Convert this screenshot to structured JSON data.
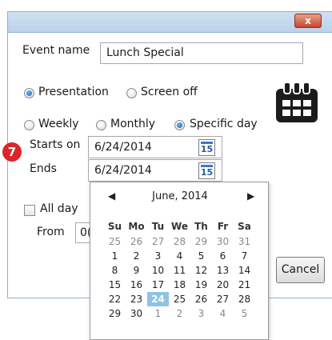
{
  "window": {
    "close_glyph": "x"
  },
  "event_name": {
    "label": "Event name",
    "value": "Lunch Special"
  },
  "mode": {
    "presentation": "Presentation",
    "screen_off": "Screen off",
    "selected": "Presentation"
  },
  "recurrence": {
    "weekly": "Weekly",
    "monthly": "Monthly",
    "specific_day": "Specific day",
    "selected": "Specific day"
  },
  "starts": {
    "label": "Starts on",
    "value": "6/24/2014",
    "icon_text": "15"
  },
  "ends": {
    "label": "Ends",
    "value": "6/24/2014",
    "icon_text": "15"
  },
  "step_badge": "7",
  "all_day": {
    "label": "All day",
    "checked": false
  },
  "from": {
    "label": "From",
    "value_partial": "0("
  },
  "calendar": {
    "prev": "◀",
    "next": "▶",
    "title": "June, 2014",
    "weekdays": [
      "Su",
      "Mo",
      "Tu",
      "We",
      "Th",
      "Fr",
      "Sa"
    ],
    "weeks": [
      [
        "25",
        "26",
        "27",
        "28",
        "29",
        "30",
        "31"
      ],
      [
        "1",
        "2",
        "3",
        "4",
        "5",
        "6",
        "7"
      ],
      [
        "8",
        "9",
        "10",
        "11",
        "12",
        "13",
        "14"
      ],
      [
        "15",
        "16",
        "17",
        "18",
        "19",
        "20",
        "21"
      ],
      [
        "22",
        "23",
        "24",
        "25",
        "26",
        "27",
        "28"
      ],
      [
        "29",
        "30",
        "1",
        "2",
        "3",
        "4",
        "5"
      ]
    ],
    "selected_day": "24"
  },
  "cancel_button": "Cancel",
  "colors": {
    "accent": "#1b5fb0",
    "selected_day": "#8fc3e4",
    "close": "#c8462a",
    "badge": "#d9262a"
  },
  "icons": [
    "close-icon",
    "calendar-icon",
    "calendar-15-icon",
    "prev-month-arrow-icon",
    "next-month-arrow-icon"
  ]
}
